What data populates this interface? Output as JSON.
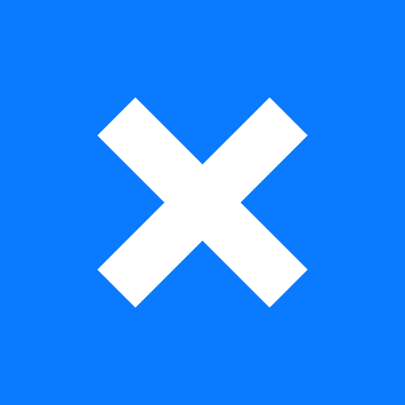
{
  "icon": {
    "name": "close-icon",
    "background_color": "#0a7bff",
    "glyph_color": "#ffffff"
  }
}
